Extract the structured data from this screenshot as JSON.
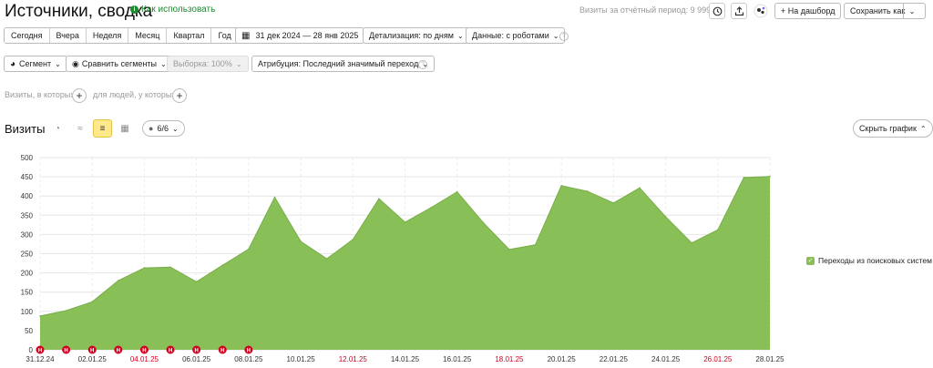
{
  "header": {
    "title": "Источники, сводка",
    "howto_label": "Как использовать",
    "visits_period": "Визиты за отчётный период: 9 999",
    "dashboard_label": "+ На дашборд",
    "save_as_label": "Сохранить как"
  },
  "period_tabs": [
    "Сегодня",
    "Вчера",
    "Неделя",
    "Месяц",
    "Квартал",
    "Год"
  ],
  "date_range": "31 дек 2024 — 28 янв 2025",
  "detail_label": "Детализация: по дням",
  "data_label": "Данные: с роботами",
  "segment_bar": {
    "segment": "Сегмент",
    "compare": "Сравнить сегменты",
    "sample": "Выборка: 100%",
    "attribution": "Атрибуция: Последний значимый переход"
  },
  "filters": {
    "visits_where": "Визиты, в которых",
    "people_where": "для людей, у которых"
  },
  "chart_toolbar": {
    "title": "Визиты",
    "series_count": "6/6",
    "hide_chart": "Скрыть график"
  },
  "legend": {
    "label": "Переходы из поисковых систем",
    "color": "#88c057"
  },
  "chart_data": {
    "type": "area",
    "series": [
      {
        "name": "Переходы из поисковых систем",
        "values": [
          88,
          102,
          125,
          180,
          213,
          215,
          177,
          220,
          262,
          397,
          282,
          237,
          287,
          393,
          332,
          370,
          411,
          331,
          261,
          273,
          427,
          412,
          382,
          421,
          346,
          278,
          312,
          448,
          451
        ]
      }
    ],
    "x_labels": [
      "31.12.24",
      "02.01.25",
      "04.01.25",
      "06.01.25",
      "08.01.25",
      "10.01.25",
      "12.01.25",
      "14.01.25",
      "16.01.25",
      "18.01.25",
      "20.01.25",
      "22.01.25",
      "24.01.25",
      "26.01.25",
      "28.01.25"
    ],
    "x_label_red": [
      false,
      false,
      true,
      false,
      false,
      false,
      true,
      false,
      false,
      true,
      false,
      false,
      false,
      true,
      false
    ],
    "y_ticks": [
      0,
      50,
      100,
      150,
      200,
      250,
      300,
      350,
      400,
      450,
      500
    ],
    "ylim": [
      0,
      500
    ],
    "holiday_markers": 9,
    "marker_letter": "Н",
    "color": "#88c057",
    "grid": true
  }
}
